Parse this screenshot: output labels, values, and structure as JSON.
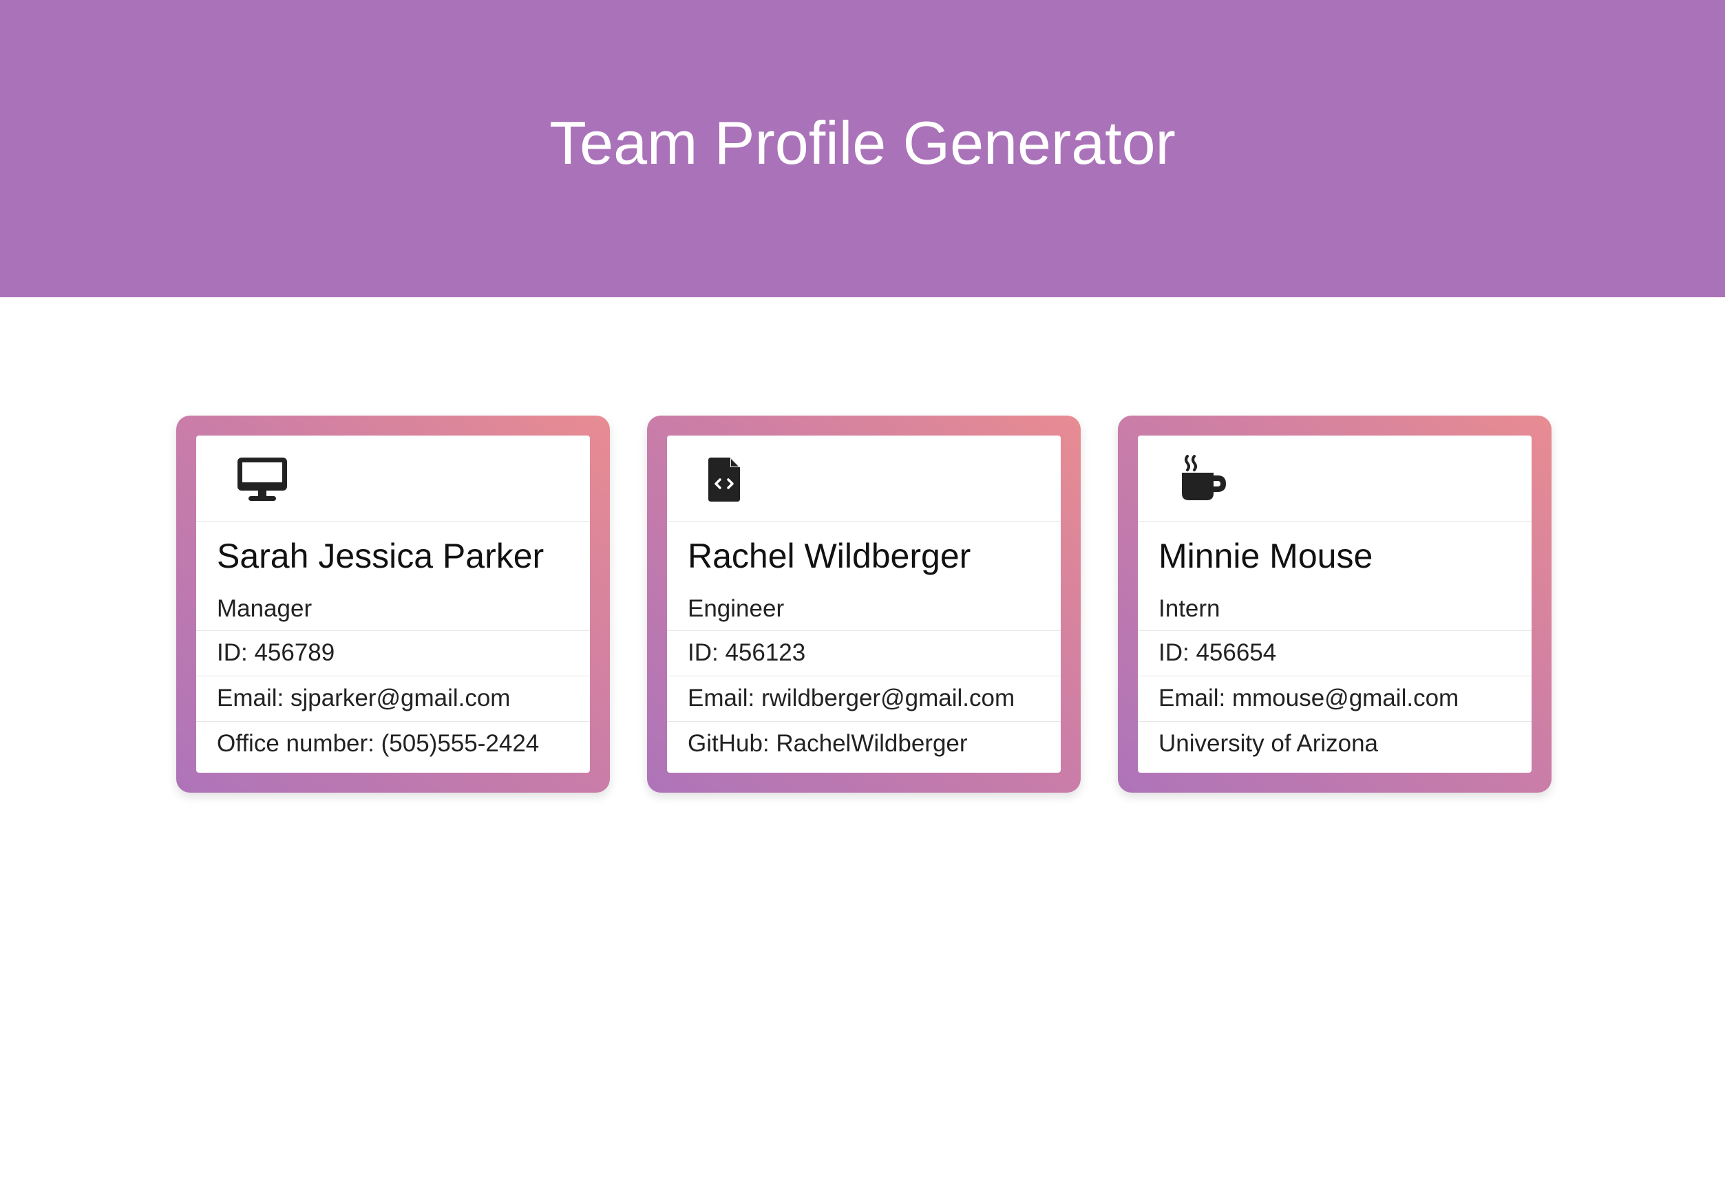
{
  "header": {
    "title": "Team Profile Generator",
    "background": "#aa72b8"
  },
  "cards": [
    {
      "icon": "desktop-icon",
      "name": "Sarah Jessica Parker",
      "role": "Manager",
      "id": "ID: 456789",
      "email": "Email: sjparker@gmail.com",
      "extra": "Office number: (505)555-2424"
    },
    {
      "icon": "file-code-icon",
      "name": "Rachel Wildberger",
      "role": "Engineer",
      "id": "ID: 456123",
      "email": "Email: rwildberger@gmail.com",
      "extra": "GitHub: RachelWildberger"
    },
    {
      "icon": "coffee-mug-icon",
      "name": "Minnie Mouse",
      "role": "Intern",
      "id": "ID: 456654",
      "email": "Email: mmouse@gmail.com",
      "extra": "University of Arizona"
    }
  ],
  "colors": {
    "card_gradient_start": "#e88c92",
    "card_gradient_end": "#ae74b9",
    "icon": "#222222"
  }
}
